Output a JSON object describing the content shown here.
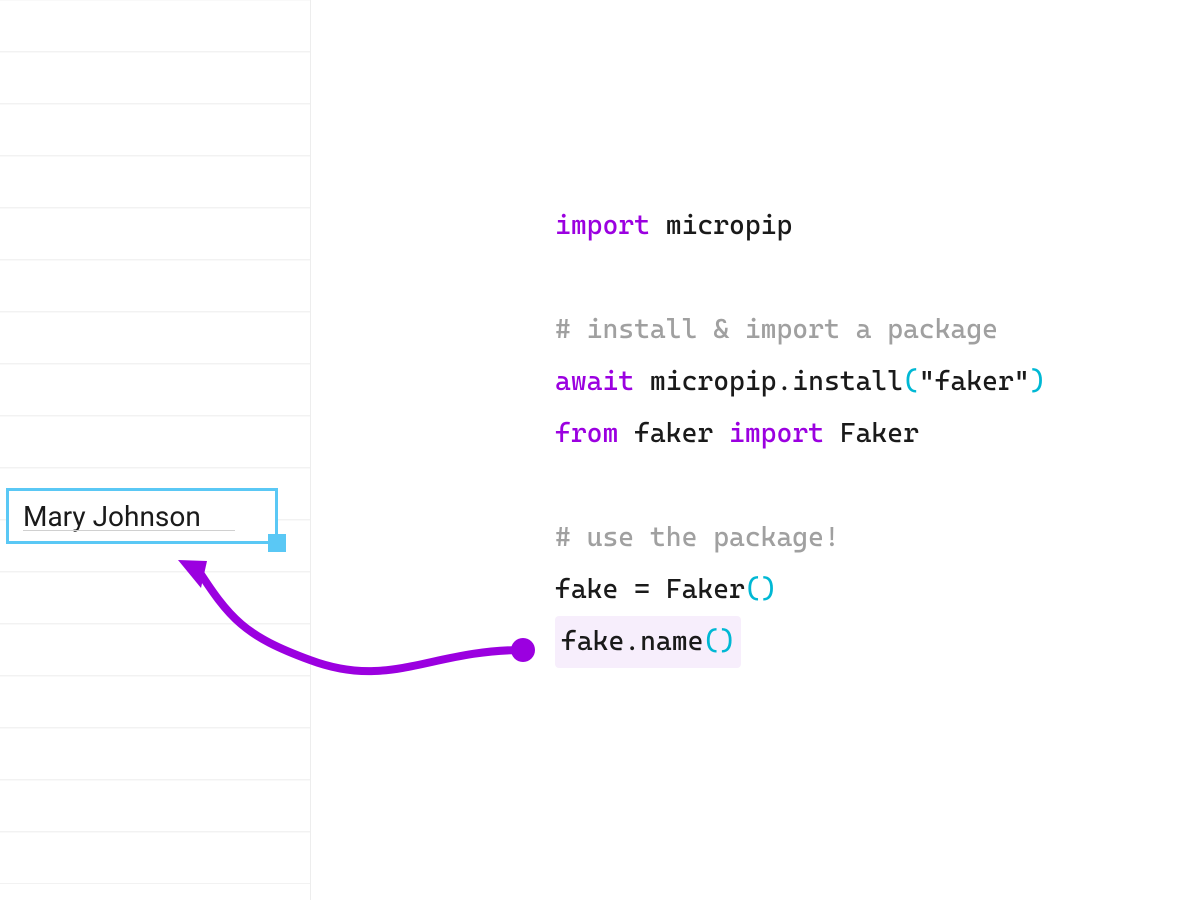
{
  "cell": {
    "value": "Mary Johnson"
  },
  "code": {
    "lines": [
      {
        "type": "stmt",
        "tokens": [
          {
            "t": "import ",
            "cls": "k"
          },
          {
            "t": "micropip",
            "cls": ""
          }
        ]
      },
      {
        "type": "blank"
      },
      {
        "type": "comment",
        "text": "# install & import a package"
      },
      {
        "type": "stmt",
        "tokens": [
          {
            "t": "await ",
            "cls": "k"
          },
          {
            "t": "micropip.install",
            "cls": ""
          },
          {
            "t": "(",
            "cls": "p"
          },
          {
            "t": "\"faker\"",
            "cls": "s"
          },
          {
            "t": ")",
            "cls": "p"
          }
        ]
      },
      {
        "type": "stmt",
        "tokens": [
          {
            "t": "from ",
            "cls": "k"
          },
          {
            "t": "faker ",
            "cls": ""
          },
          {
            "t": "import ",
            "cls": "k"
          },
          {
            "t": "Faker",
            "cls": ""
          }
        ]
      },
      {
        "type": "blank"
      },
      {
        "type": "comment",
        "text": "# use the package!"
      },
      {
        "type": "stmt",
        "tokens": [
          {
            "t": "fake = Faker",
            "cls": ""
          },
          {
            "t": "()",
            "cls": "p"
          }
        ]
      },
      {
        "type": "stmt",
        "highlight": true,
        "tokens": [
          {
            "t": "fake.name",
            "cls": ""
          },
          {
            "t": "()",
            "cls": "p"
          }
        ]
      }
    ]
  },
  "colors": {
    "keyword": "#9b00e0",
    "comment": "#a0a0a0",
    "paren": "#00b8d4",
    "selection": "#5ac8f5",
    "arrow": "#9b00e0"
  }
}
